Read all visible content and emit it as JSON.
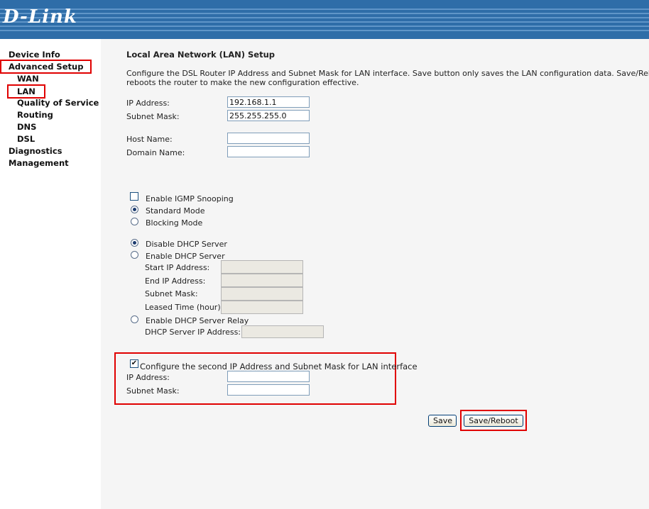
{
  "brand": {
    "logo_text": "D-Link"
  },
  "sidebar": {
    "items": [
      {
        "label": "Device Info"
      },
      {
        "label": "Advanced Setup"
      },
      {
        "label": "WAN"
      },
      {
        "label": "LAN"
      },
      {
        "label": "Quality of Service"
      },
      {
        "label": "Routing"
      },
      {
        "label": "DNS"
      },
      {
        "label": "DSL"
      },
      {
        "label": "Diagnostics"
      },
      {
        "label": "Management"
      }
    ]
  },
  "main": {
    "title": "Local Area Network (LAN) Setup",
    "description_line1": "Configure the DSL Router IP Address and Subnet Mask for LAN interface.  Save button only saves the LAN configuration data.  Save/Reboot b",
    "description_line2": "reboots the router to make the new configuration effective.",
    "ip_address_label": "IP Address:",
    "ip_address_value": "192.168.1.1",
    "subnet_mask_label": "Subnet Mask:",
    "subnet_mask_value": "255.255.255.0",
    "host_name_label": "Host Name:",
    "host_name_value": "",
    "domain_name_label": "Domain Name:",
    "domain_name_value": "",
    "igmp": {
      "enable_label": "Enable IGMP Snooping",
      "enable_checked": false,
      "standard_label": "Standard Mode",
      "blocking_label": "Blocking Mode"
    },
    "dhcp": {
      "disable_label": "Disable DHCP Server",
      "enable_label": "Enable DHCP Server",
      "start_ip_label": "Start IP Address:",
      "end_ip_label": "End IP Address:",
      "subnet_mask_label": "Subnet Mask:",
      "leased_time_label": "Leased Time (hour):",
      "relay_label": "Enable DHCP Server Relay",
      "relay_ip_label": "DHCP Server IP Address:"
    },
    "second_ip": {
      "checkbox_label": "Configure the second IP Address and Subnet Mask for LAN interface",
      "checked": true,
      "ip_label": "IP Address:",
      "ip_value": "",
      "subnet_label": "Subnet Mask:",
      "subnet_value": ""
    },
    "buttons": {
      "save": "Save",
      "save_reboot": "Save/Reboot"
    }
  },
  "colors": {
    "header_bg": "#2e6da8",
    "highlight_red": "#e00000",
    "main_bg": "#f5f5f5"
  }
}
